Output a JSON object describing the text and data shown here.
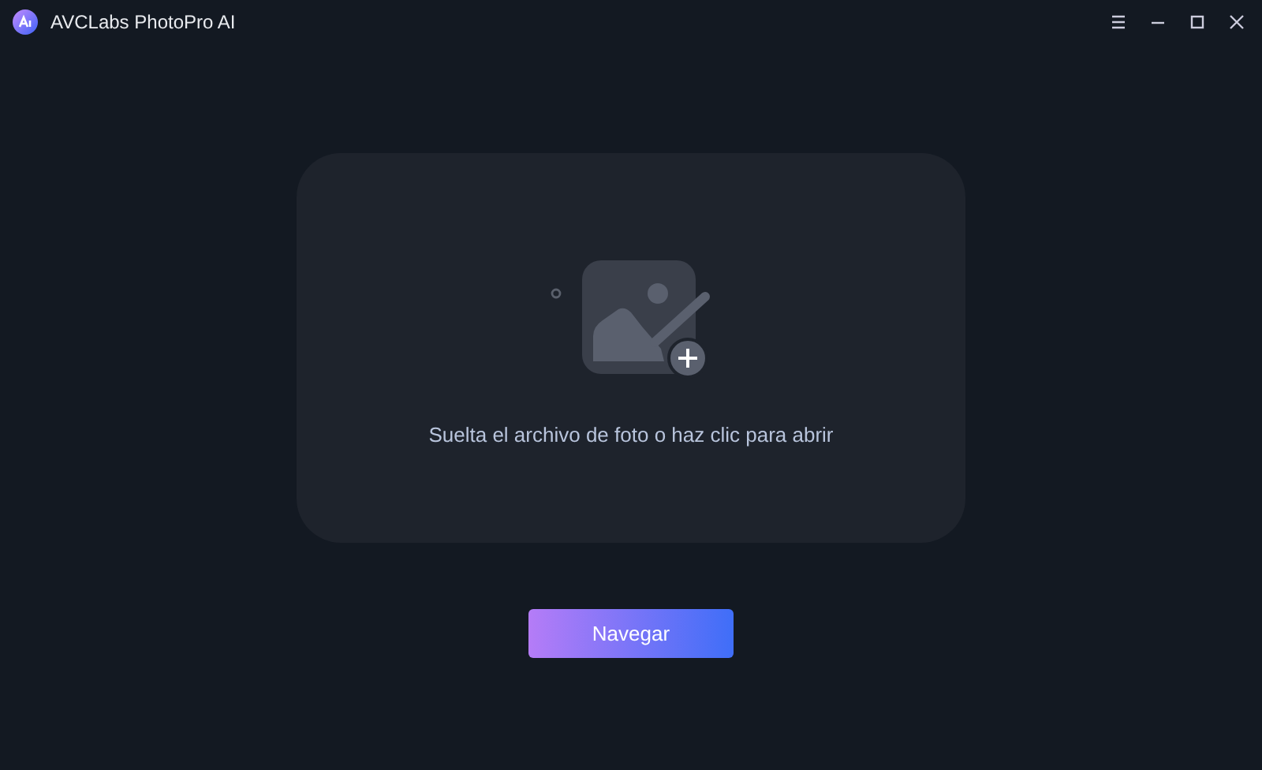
{
  "window": {
    "title": "AVCLabs PhotoPro AI"
  },
  "dropzone": {
    "text": "Suelta el archivo de foto o haz clic para abrir"
  },
  "buttons": [
    {
      "label": "Navegar"
    }
  ]
}
